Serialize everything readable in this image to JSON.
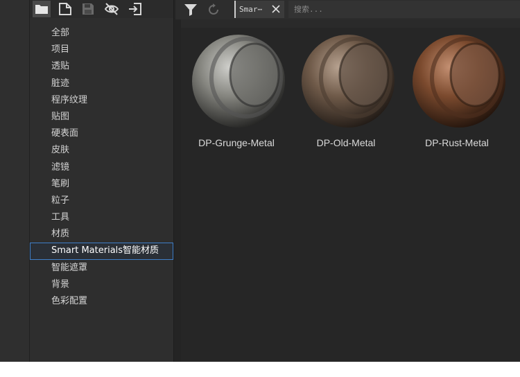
{
  "left_toolbar": {
    "buttons": [
      {
        "name": "folder-icon",
        "active": true
      },
      {
        "name": "new-document-icon",
        "active": false
      },
      {
        "name": "save-icon",
        "active": false
      },
      {
        "name": "hide-eye-icon",
        "active": false
      },
      {
        "name": "import-icon",
        "active": false
      }
    ]
  },
  "categories": [
    {
      "label": "全部"
    },
    {
      "label": "项目"
    },
    {
      "label": "透贴"
    },
    {
      "label": "脏迹"
    },
    {
      "label": "程序纹理"
    },
    {
      "label": "贴图"
    },
    {
      "label": "硬表面"
    },
    {
      "label": "皮肤"
    },
    {
      "label": "滤镜"
    },
    {
      "label": "笔刷"
    },
    {
      "label": "粒子"
    },
    {
      "label": "工具"
    },
    {
      "label": "材质"
    },
    {
      "label": "Smart Materials智能材质"
    },
    {
      "label": "智能遮罩"
    },
    {
      "label": "背景"
    },
    {
      "label": "色彩配置"
    }
  ],
  "selected_category": "Smart Materials智能材质",
  "right_toolbar": {
    "filter_icon": "filter-icon",
    "reset_icon": "refresh-icon",
    "active_tag": "Smar⋯",
    "close_icon": "close-icon"
  },
  "search": {
    "value": "",
    "placeholder": "搜索..."
  },
  "materials": [
    {
      "name": "DP-Grunge-Metal",
      "tint": "#8a8a86"
    },
    {
      "name": "DP-Old-Metal",
      "tint": "#7a6350"
    },
    {
      "name": "DP-Rust-Metal",
      "tint": "#8a5a3a"
    }
  ]
}
